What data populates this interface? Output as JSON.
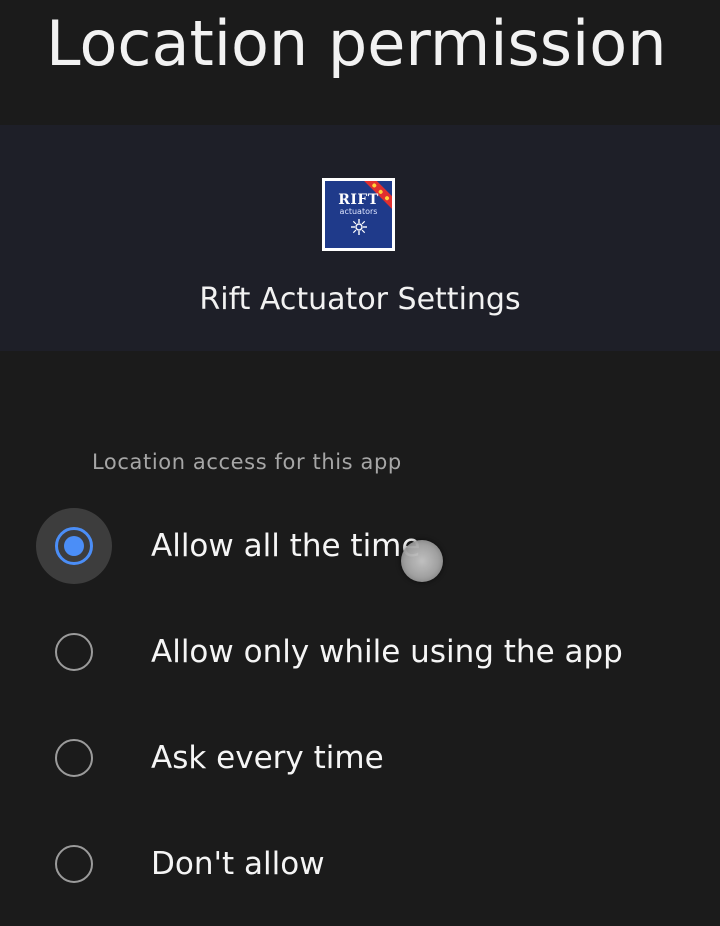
{
  "header": {
    "title": "Location permission"
  },
  "app": {
    "name": "Rift Actuator Settings",
    "icon": {
      "name": "rift-actuators-app-icon",
      "line1": "RIFT",
      "line2": "actuators",
      "background_color": "#1f3a8a",
      "ribbon_color": "#e02f2f"
    }
  },
  "section": {
    "label": "Location access for this app"
  },
  "options": [
    {
      "label": "Allow all the time",
      "selected": true
    },
    {
      "label": "Allow only while using the app",
      "selected": false
    },
    {
      "label": "Ask every time",
      "selected": false
    },
    {
      "label": "Don't allow",
      "selected": false
    }
  ],
  "colors": {
    "background": "#1b1b1b",
    "app_card_background": "#1e1f28",
    "accent": "#4b8ef7",
    "secondary_text": "#a6a6a6"
  }
}
